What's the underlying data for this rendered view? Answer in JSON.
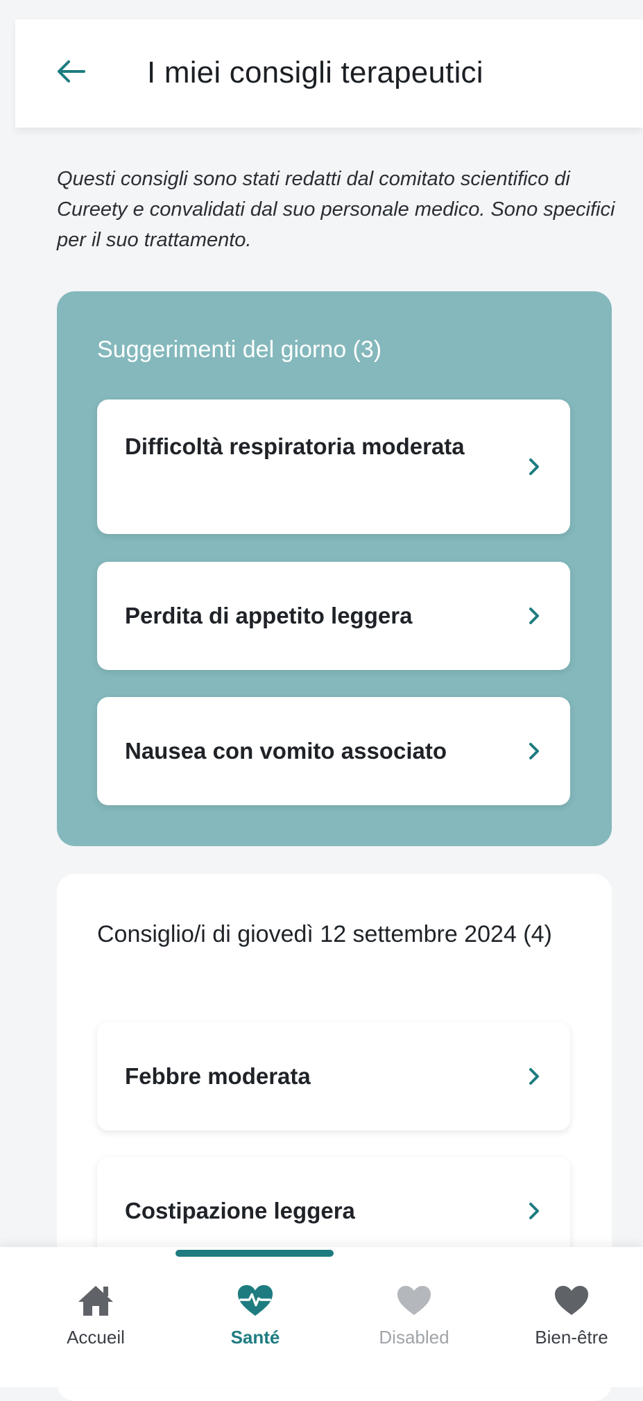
{
  "header": {
    "title": "I miei consigli terapeutici",
    "back_icon": "arrow-left-icon"
  },
  "intro": "Questi consigli sono stati redatti dal comitato scientifico di Cureety e convalidati dal suo personale medico. Sono specifici per il suo trattamento.",
  "tips_of_day": {
    "title": "Suggerimenti del giorno (3)",
    "items": [
      {
        "label": "Difficoltà respiratoria moderata"
      },
      {
        "label": "Perdita di appetito leggera"
      },
      {
        "label": "Nausea con vomito associato"
      }
    ]
  },
  "day_advice": {
    "title": "Consiglio/i di giovedì 12 settembre 2024 (4)",
    "items": [
      {
        "label": "Febbre moderata"
      },
      {
        "label": "Costipazione leggera"
      }
    ]
  },
  "bottom_nav": {
    "items": [
      {
        "label": "Accueil",
        "icon": "home-icon"
      },
      {
        "label": "Santé",
        "icon": "heart-pulse-icon"
      },
      {
        "label": "Disabled",
        "icon": "heart-icon"
      },
      {
        "label": "Bien-être",
        "icon": "heart-icon"
      }
    ]
  },
  "colors": {
    "accent": "#1e7c80",
    "panel": "#84b8bc",
    "disabled": "#b4b8bc",
    "icon_gray": "#5f6368"
  }
}
